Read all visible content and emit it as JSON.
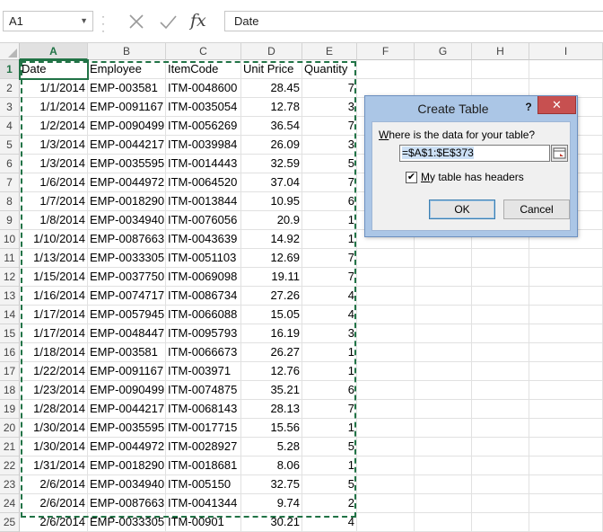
{
  "formula_bar": {
    "name_box": "A1",
    "formula": "Date"
  },
  "columns": [
    "A",
    "B",
    "C",
    "D",
    "E",
    "F",
    "G",
    "H",
    "I"
  ],
  "rows": [
    {
      "n": "1",
      "a": "Date",
      "b": "Employee",
      "c": "ItemCode",
      "d": "Unit Price",
      "e": "Quantity"
    },
    {
      "n": "2",
      "a": "1/1/2014",
      "b": "EMP-003581",
      "c": "ITM-0048600",
      "d": "28.45",
      "e": "7"
    },
    {
      "n": "3",
      "a": "1/1/2014",
      "b": "EMP-0091167",
      "c": "ITM-0035054",
      "d": "12.78",
      "e": "3"
    },
    {
      "n": "4",
      "a": "1/2/2014",
      "b": "EMP-0090499",
      "c": "ITM-0056269",
      "d": "36.54",
      "e": "7"
    },
    {
      "n": "5",
      "a": "1/3/2014",
      "b": "EMP-0044217",
      "c": "ITM-0039984",
      "d": "26.09",
      "e": "3"
    },
    {
      "n": "6",
      "a": "1/3/2014",
      "b": "EMP-0035595",
      "c": "ITM-0014443",
      "d": "32.59",
      "e": "5"
    },
    {
      "n": "7",
      "a": "1/6/2014",
      "b": "EMP-0044972",
      "c": "ITM-0064520",
      "d": "37.04",
      "e": "7"
    },
    {
      "n": "8",
      "a": "1/7/2014",
      "b": "EMP-0018290",
      "c": "ITM-0013844",
      "d": "10.95",
      "e": "6"
    },
    {
      "n": "9",
      "a": "1/8/2014",
      "b": "EMP-0034940",
      "c": "ITM-0076056",
      "d": "20.9",
      "e": "1"
    },
    {
      "n": "10",
      "a": "1/10/2014",
      "b": "EMP-0087663",
      "c": "ITM-0043639",
      "d": "14.92",
      "e": "1"
    },
    {
      "n": "11",
      "a": "1/13/2014",
      "b": "EMP-0033305",
      "c": "ITM-0051103",
      "d": "12.69",
      "e": "7"
    },
    {
      "n": "12",
      "a": "1/15/2014",
      "b": "EMP-0037750",
      "c": "ITM-0069098",
      "d": "19.11",
      "e": "7"
    },
    {
      "n": "13",
      "a": "1/16/2014",
      "b": "EMP-0074717",
      "c": "ITM-0086734",
      "d": "27.26",
      "e": "4"
    },
    {
      "n": "14",
      "a": "1/17/2014",
      "b": "EMP-0057945",
      "c": "ITM-0066088",
      "d": "15.05",
      "e": "4"
    },
    {
      "n": "15",
      "a": "1/17/2014",
      "b": "EMP-0048447",
      "c": "ITM-0095793",
      "d": "16.19",
      "e": "3"
    },
    {
      "n": "16",
      "a": "1/18/2014",
      "b": "EMP-003581",
      "c": "ITM-0066673",
      "d": "26.27",
      "e": "1"
    },
    {
      "n": "17",
      "a": "1/22/2014",
      "b": "EMP-0091167",
      "c": "ITM-003971",
      "d": "12.76",
      "e": "1"
    },
    {
      "n": "18",
      "a": "1/23/2014",
      "b": "EMP-0090499",
      "c": "ITM-0074875",
      "d": "35.21",
      "e": "6"
    },
    {
      "n": "19",
      "a": "1/28/2014",
      "b": "EMP-0044217",
      "c": "ITM-0068143",
      "d": "28.13",
      "e": "7"
    },
    {
      "n": "20",
      "a": "1/30/2014",
      "b": "EMP-0035595",
      "c": "ITM-0017715",
      "d": "15.56",
      "e": "1"
    },
    {
      "n": "21",
      "a": "1/30/2014",
      "b": "EMP-0044972",
      "c": "ITM-0028927",
      "d": "5.28",
      "e": "5"
    },
    {
      "n": "22",
      "a": "1/31/2014",
      "b": "EMP-0018290",
      "c": "ITM-0018681",
      "d": "8.06",
      "e": "1"
    },
    {
      "n": "23",
      "a": "2/6/2014",
      "b": "EMP-0034940",
      "c": "ITM-005150",
      "d": "32.75",
      "e": "5"
    },
    {
      "n": "24",
      "a": "2/6/2014",
      "b": "EMP-0087663",
      "c": "ITM-0041344",
      "d": "9.74",
      "e": "2"
    },
    {
      "n": "25",
      "a": "2/6/2014",
      "b": "EMP-0033305",
      "c": "ITM-00901",
      "d": "30.21",
      "e": "4"
    }
  ],
  "dialog": {
    "title": "Create Table",
    "help": "?",
    "prompt_before": "",
    "prompt_accel": "W",
    "prompt_after": "here is the data for your table?",
    "range": "=$A$1:$E$373",
    "headers_checked": true,
    "headers_accel": "M",
    "headers_label_after": "y table has headers",
    "ok_label": "OK",
    "cancel_label": "Cancel"
  }
}
